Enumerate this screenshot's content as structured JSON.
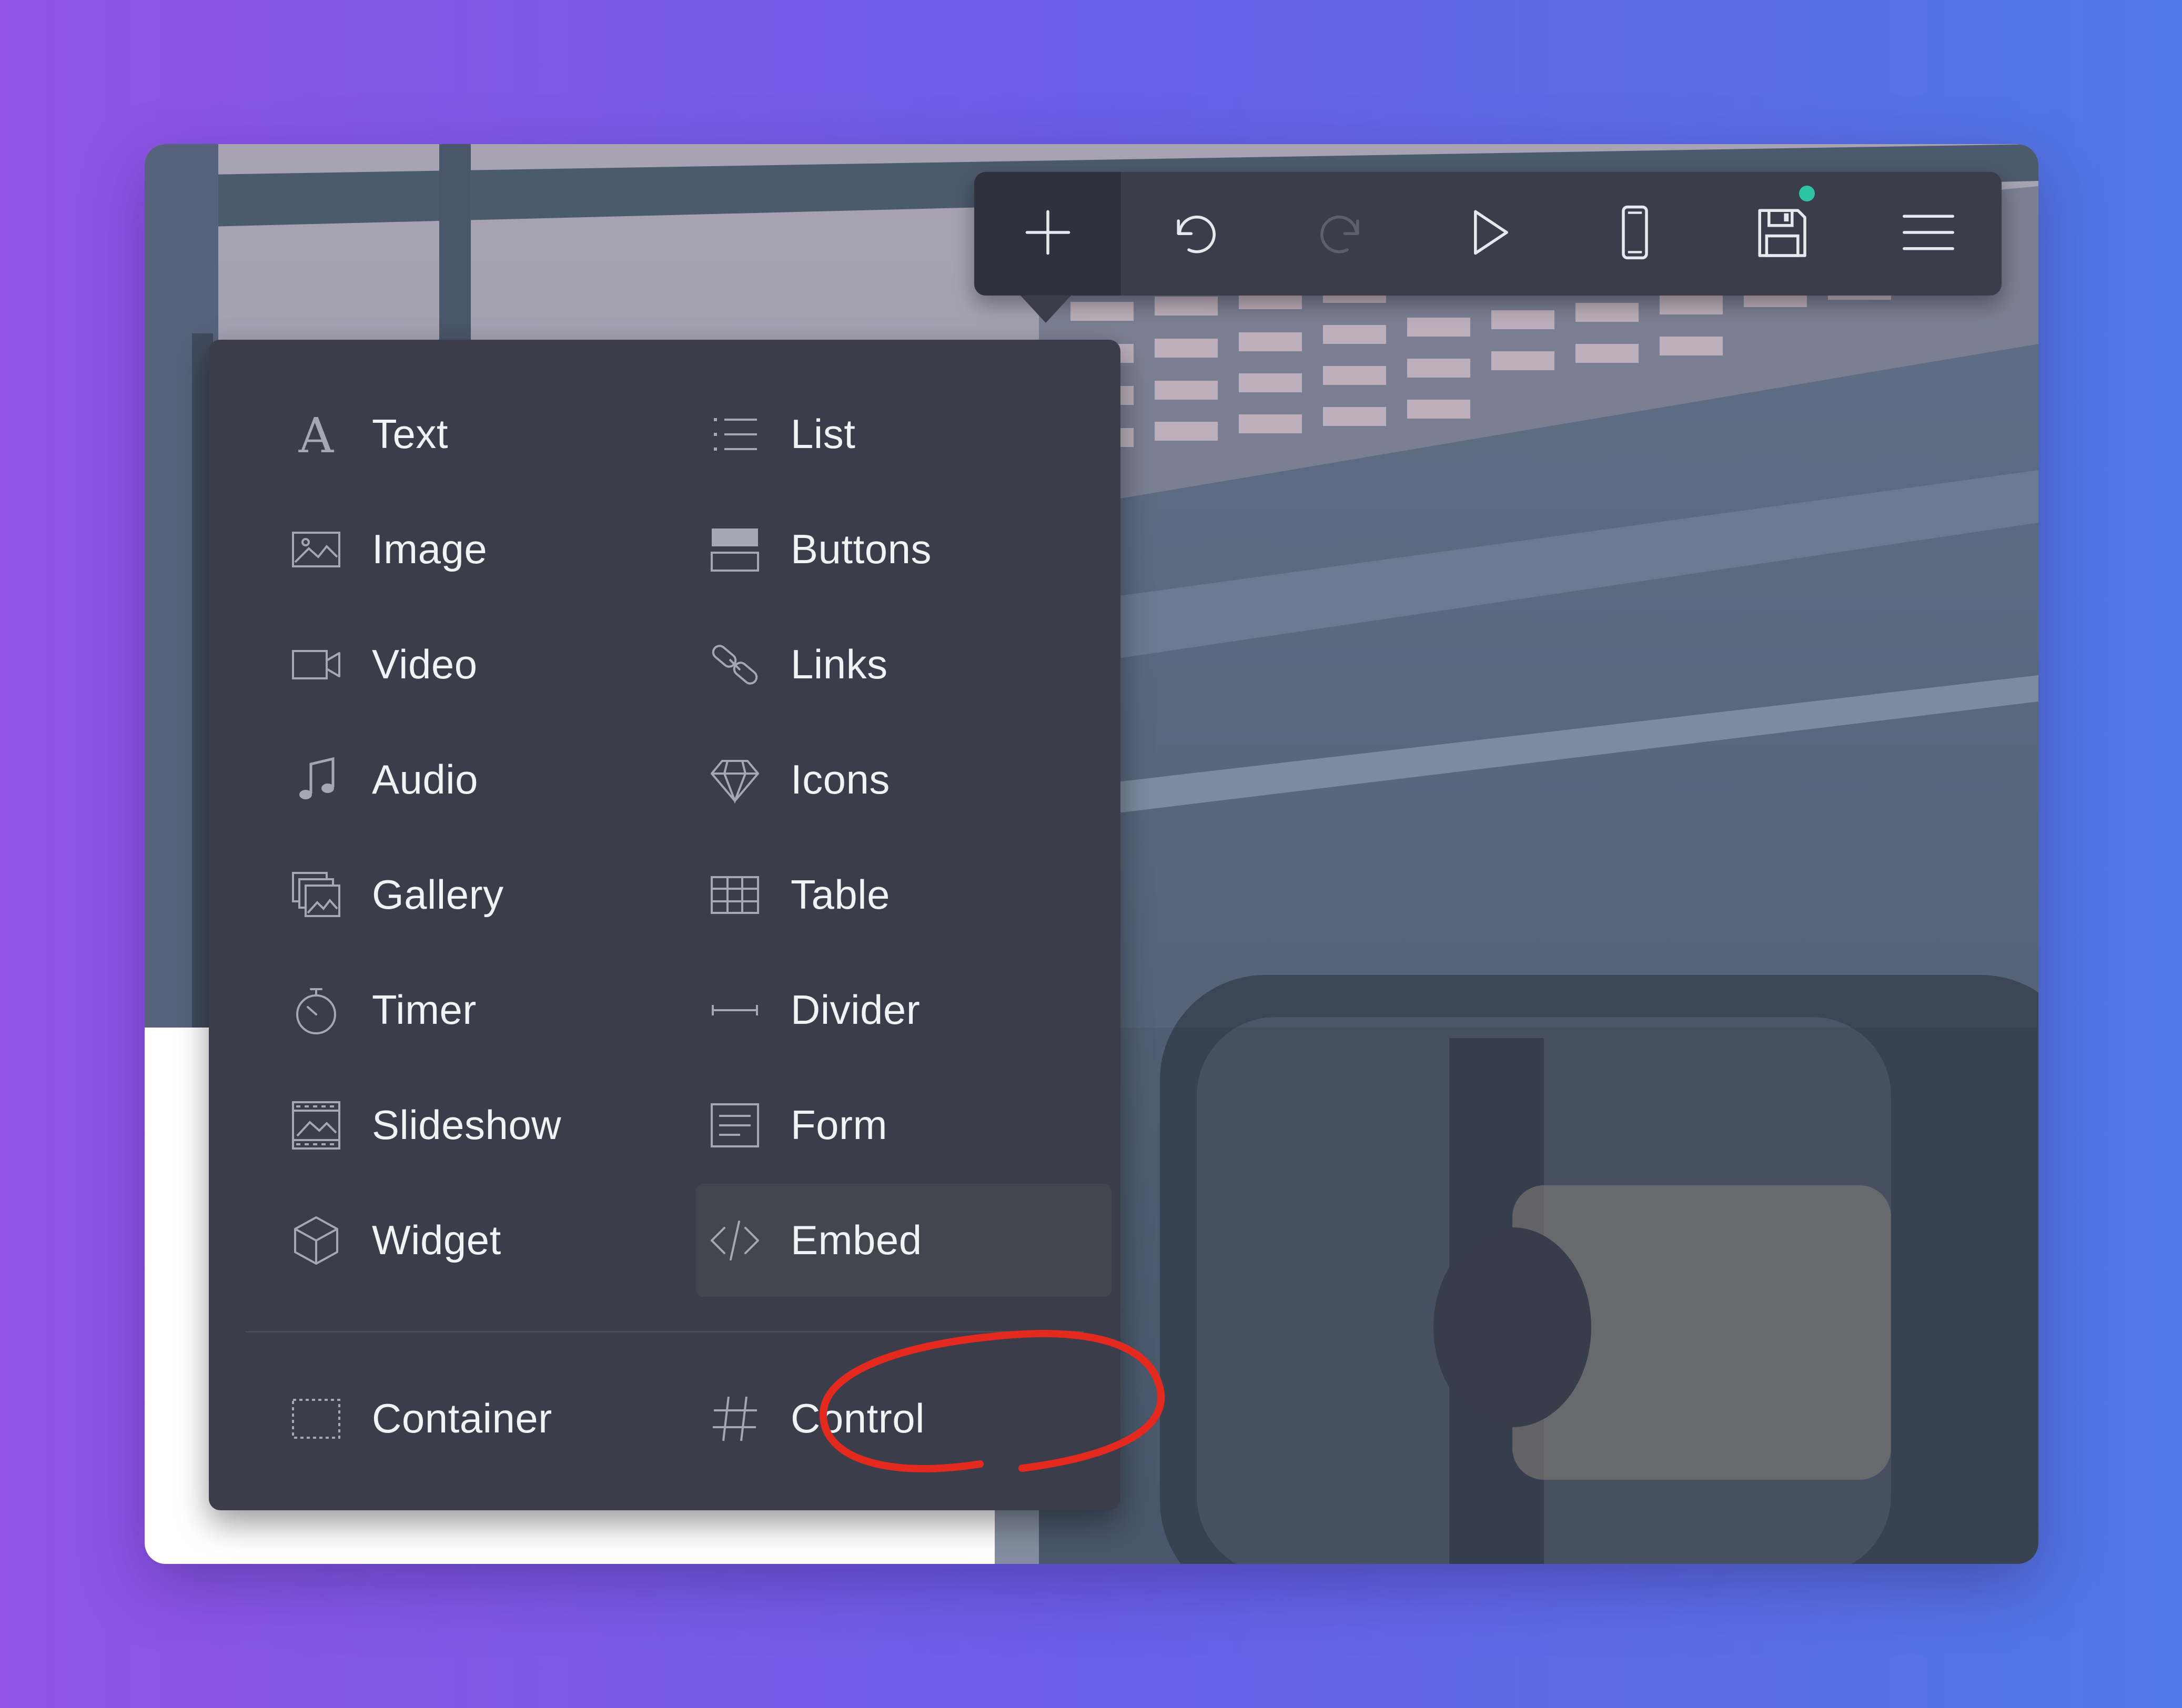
{
  "colors": {
    "toolbar_bg": "#3b3d4a",
    "menu_bg": "#3b3d4a",
    "item_text": "#f2f3f6",
    "icon": "#9ea3ad",
    "status_dot": "#2ec4a6",
    "annotation": "#e42a1f"
  },
  "toolbar": {
    "buttons": [
      {
        "icon": "plus-icon",
        "state": "active"
      },
      {
        "icon": "undo-icon",
        "state": "enabled"
      },
      {
        "icon": "redo-icon",
        "state": "disabled"
      },
      {
        "icon": "play-icon",
        "state": "enabled"
      },
      {
        "icon": "mobile-device-icon",
        "state": "enabled"
      },
      {
        "icon": "save-icon",
        "state": "enabled",
        "status_dot": true
      },
      {
        "icon": "hamburger-menu-icon",
        "state": "enabled"
      }
    ]
  },
  "menu": {
    "left": [
      {
        "label": "Text",
        "icon": "text-a-icon"
      },
      {
        "label": "Image",
        "icon": "image-icon"
      },
      {
        "label": "Video",
        "icon": "video-camera-icon"
      },
      {
        "label": "Audio",
        "icon": "music-note-icon"
      },
      {
        "label": "Gallery",
        "icon": "gallery-icon"
      },
      {
        "label": "Timer",
        "icon": "stopwatch-icon"
      },
      {
        "label": "Slideshow",
        "icon": "slideshow-icon"
      },
      {
        "label": "Widget",
        "icon": "cube-icon"
      }
    ],
    "right": [
      {
        "label": "List",
        "icon": "list-icon"
      },
      {
        "label": "Buttons",
        "icon": "buttons-icon"
      },
      {
        "label": "Links",
        "icon": "chain-link-icon"
      },
      {
        "label": "Icons",
        "icon": "diamond-icon"
      },
      {
        "label": "Table",
        "icon": "table-icon"
      },
      {
        "label": "Divider",
        "icon": "divider-icon"
      },
      {
        "label": "Form",
        "icon": "form-icon"
      },
      {
        "label": "Embed",
        "icon": "code-embed-icon",
        "highlighted": true
      }
    ],
    "bottom": [
      {
        "label": "Container",
        "icon": "dashed-box-icon"
      },
      {
        "label": "Control",
        "icon": "hash-icon"
      }
    ]
  }
}
